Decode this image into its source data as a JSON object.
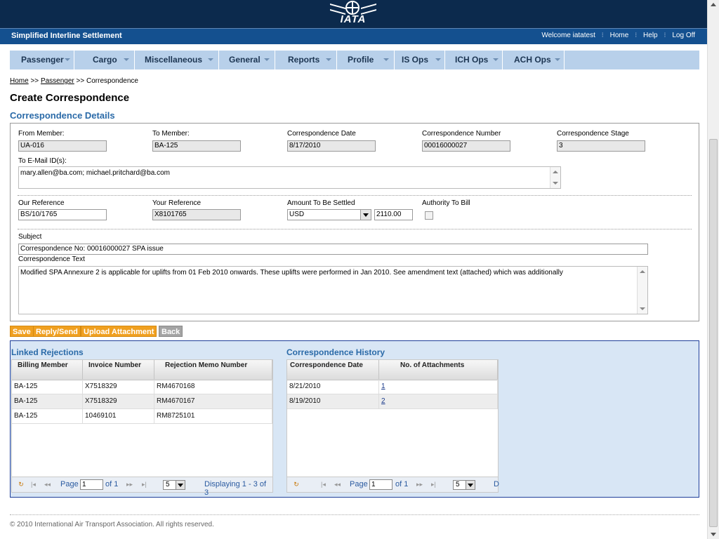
{
  "header": {
    "logo_text": "IATA",
    "app_name": "Simplified Interline Settlement",
    "welcome": "Welcome iatatest",
    "links": [
      "Home",
      "Help",
      "Log Off"
    ]
  },
  "nav": [
    "Passenger",
    "Cargo",
    "Miscellaneous",
    "General",
    "Reports",
    "Profile",
    "IS Ops",
    "ICH Ops",
    "ACH Ops"
  ],
  "breadcrumb": {
    "home": "Home",
    "passenger": "Passenger",
    "sep": ">>",
    "current": "Correspondence"
  },
  "page_title": "Create Correspondence",
  "section_title": "Correspondence Details",
  "form": {
    "from_member": {
      "label": "From Member:",
      "value": "UA-016"
    },
    "to_member": {
      "label": "To Member:",
      "value": "BA-125"
    },
    "corr_date": {
      "label": "Correspondence Date",
      "value": "8/17/2010"
    },
    "corr_number": {
      "label": "Correspondence Number",
      "value": "00016000027"
    },
    "corr_stage": {
      "label": "Correspondence Stage",
      "value": "3"
    },
    "to_email": {
      "label": "To E-Mail ID(s):",
      "value": "mary.allen@ba.com; michael.pritchard@ba.com"
    },
    "our_ref": {
      "label": "Our Reference",
      "value": "BS/10/1765"
    },
    "your_ref": {
      "label": "Your Reference",
      "value": "X8101765"
    },
    "amount": {
      "label": "Amount To Be Settled",
      "currency": "USD",
      "value": "2110.00"
    },
    "authority": {
      "label": "Authority To Bill",
      "checked": false
    },
    "subject": {
      "label": "Subject",
      "value": "Correspondence No: 00016000027   SPA issue"
    },
    "corr_text": {
      "label": "Correspondence Text",
      "value": "Modified SPA Annexure 2 is applicable for uplifts from 01 Feb 2010 onwards. These uplifts were performed in Jan 2010. See amendment text (attached) which was additionally"
    }
  },
  "buttons": {
    "save": "Save",
    "reply_send": "Reply/Send",
    "upload": "Upload Attachment",
    "back": "Back"
  },
  "linked_rejections": {
    "title": "Linked Rejections",
    "columns": [
      "Billing Member",
      "Invoice Number",
      "Rejection Memo Number"
    ],
    "rows": [
      [
        "BA-125",
        "X7518329",
        "RM4670168"
      ],
      [
        "BA-125",
        "X7518329",
        "RM4670167"
      ],
      [
        "BA-125",
        "10469101",
        "RM8725101"
      ]
    ],
    "pager": {
      "page_label": "Page",
      "page": "1",
      "of": "of 1",
      "size": "5",
      "display": "Displaying 1 - 3 of 3"
    }
  },
  "history": {
    "title": "Correspondence History",
    "columns": [
      "Correspondence Date",
      "No. of Attachments"
    ],
    "rows": [
      [
        "8/21/2010",
        "1"
      ],
      [
        "8/19/2010",
        "2"
      ]
    ],
    "pager": {
      "page_label": "Page",
      "page": "1",
      "of": "of 1",
      "size": "5",
      "display": "D"
    }
  },
  "footer": "© 2010 International Air Transport Association. All rights reserved."
}
